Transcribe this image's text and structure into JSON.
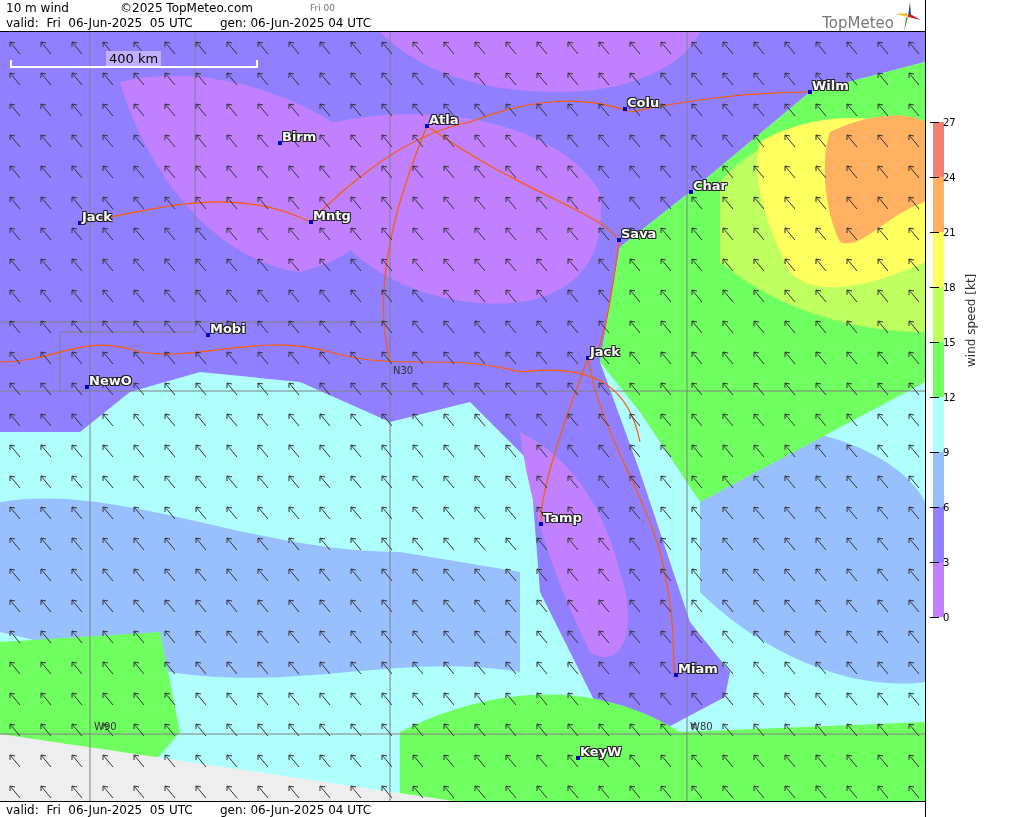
{
  "header": {
    "title": "10 m wind",
    "copyright": "©2025 TopMeteo.com",
    "run": "Fri 00",
    "valid": "valid:  Fri  06-Jun-2025  05 UTC",
    "generated": "gen: 06-Jun-2025 04 UTC",
    "logo": "TopMeteo"
  },
  "map": {
    "scale": "400 km",
    "cities": [
      "Wilm",
      "Colu",
      "Atla",
      "Birm",
      "Char",
      "Jack",
      "Mntg",
      "Sava",
      "Mobi",
      "Jack",
      "NewO",
      "Tamp",
      "Miam",
      "KeyW"
    ],
    "grid_labels": [
      "N30",
      "W90",
      "W80"
    ]
  },
  "legend": {
    "title": "wind speed [kt]",
    "ticks": [
      "27",
      "24",
      "21",
      "18",
      "15",
      "12",
      "9",
      "6",
      "3",
      "0"
    ],
    "bands": [
      {
        "color": "#f08070"
      },
      {
        "color": "#ffb060"
      },
      {
        "color": "#ffff60"
      },
      {
        "color": "#c0ff60"
      },
      {
        "color": "#70ff60"
      },
      {
        "color": "#b0ffff"
      },
      {
        "color": "#98c0ff"
      },
      {
        "color": "#9080ff"
      },
      {
        "color": "#c080ff"
      }
    ]
  },
  "footer": {
    "valid": "valid:  Fri  06-Jun-2025  05 UTC",
    "generated": "gen: 06-Jun-2025 04 UTC"
  }
}
